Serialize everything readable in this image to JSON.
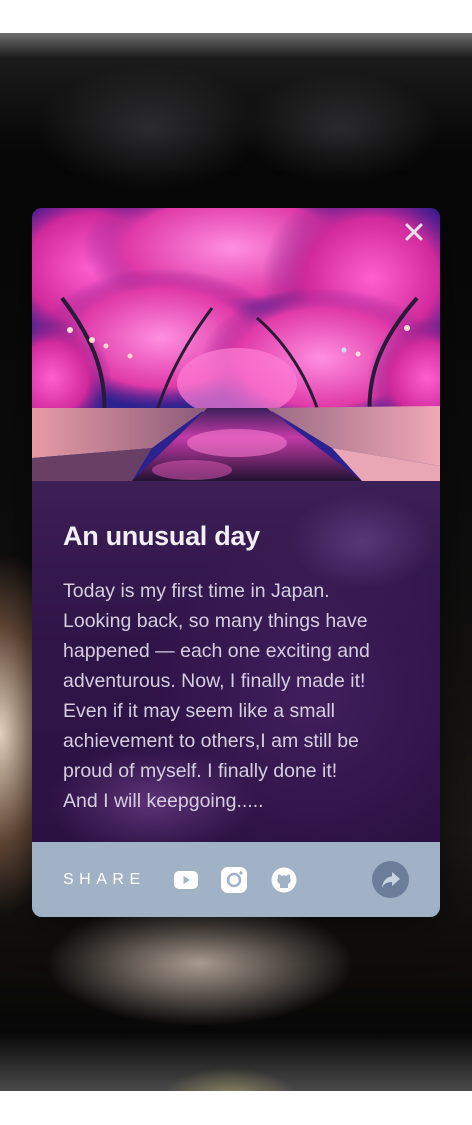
{
  "card": {
    "title": "An unusual day",
    "text": "Today is my first time in Japan.\nLooking back, so many things have\nhappened — each one exciting and\nadventurous. Now, I finally made it!\nEven if it may seem like a small\nachievement to others,I am still be\nproud of myself. I finally done it!\nAnd I will keepgoing.....",
    "close_icon": "close-icon",
    "hero_image": "cherry-blossom-canal-night-photo"
  },
  "share": {
    "label": "SHARE",
    "icons": [
      "youtube-icon",
      "instagram-icon",
      "github-icon"
    ],
    "forward_icon": "share-forward-icon"
  },
  "colors": {
    "card_body": "#2b1142",
    "share_bar": "#a2b2c6",
    "forward_button": "#6b7d98",
    "title": "#f3eef8",
    "text": "#d6cde0"
  }
}
